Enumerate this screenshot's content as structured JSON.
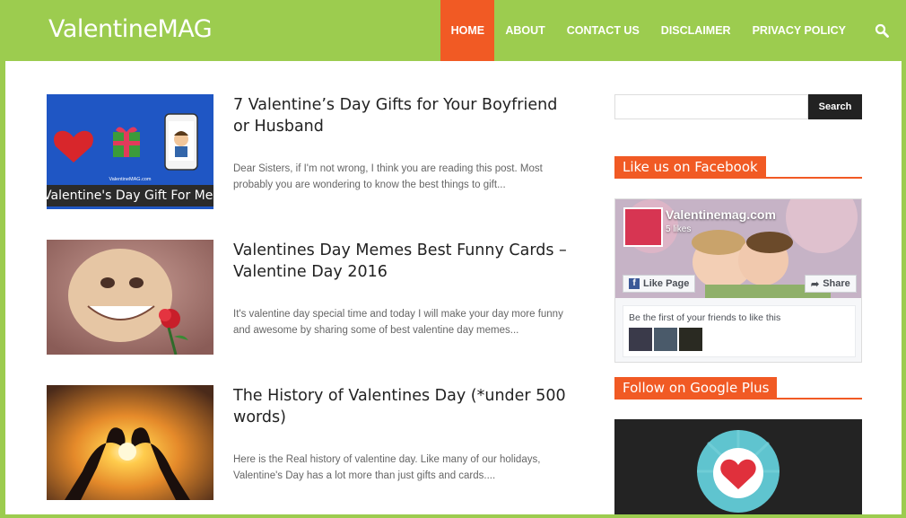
{
  "header": {
    "logo": "ValentineMAG",
    "nav": [
      {
        "label": "HOME",
        "active": true
      },
      {
        "label": "ABOUT"
      },
      {
        "label": "CONTACT US"
      },
      {
        "label": "DISCLAIMER"
      },
      {
        "label": "PRIVACY POLICY"
      }
    ],
    "search_icon": "search-icon"
  },
  "posts": [
    {
      "title": "7 Valentine’s Day Gifts for Your Boyfriend or Husband",
      "excerpt": "Dear Sisters, if I'm not wrong, I think you are reading this post. Most probably you are wondering to know the best things to gift...",
      "thumb_caption": "Valentine's Day Gift For Men",
      "thumb_watermark": "ValentineMAG.com"
    },
    {
      "title": "Valentines Day Memes Best Funny Cards – Valentine Day 2016",
      "excerpt": "It's valentine day special time and today I will make your day more funny and awesome by sharing some of best valentine day memes..."
    },
    {
      "title": "The History of Valentines Day (*under 500 words)",
      "excerpt": "Here is the Real history of valentine day. Like many of our holidays, Valentine's Day has a lot more than just gifts and cards...."
    }
  ],
  "sidebar": {
    "search_placeholder": "",
    "search_button": "Search",
    "facebook_title": "Like us on Facebook",
    "fb_page_name": "Valentinemag.com",
    "fb_likes": "5 likes",
    "fb_like_button": "Like Page",
    "fb_share_button": "Share",
    "fb_friends_text": "Be the first of your friends to like this",
    "gplus_title": "Follow on Google Plus"
  },
  "colors": {
    "brand_green": "#9ccc4f",
    "accent_orange": "#f15a24"
  }
}
